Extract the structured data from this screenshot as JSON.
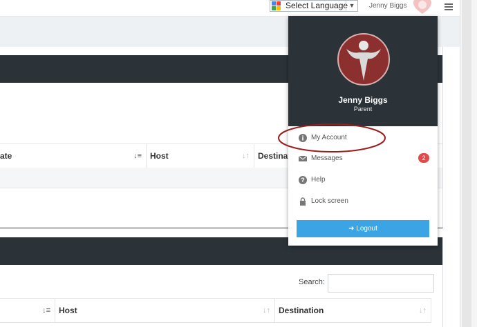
{
  "topbar": {
    "language_select": "Select Language",
    "username": "Jenny Biggs"
  },
  "table1": {
    "columns": [
      "ate",
      "Host",
      "Destinat"
    ]
  },
  "table2": {
    "search_label": "Search:",
    "search_value": "",
    "columns": [
      "",
      "Host",
      "Destination"
    ]
  },
  "dropdown": {
    "name": "Jenny Biggs",
    "role": "Parent",
    "items": [
      {
        "label": "My Account",
        "icon": "info-icon"
      },
      {
        "label": "Messages",
        "icon": "envelope-icon",
        "badge": "2"
      },
      {
        "label": "Help",
        "icon": "question-icon"
      },
      {
        "label": "Lock screen",
        "icon": "lock-icon"
      }
    ],
    "logout_label": "Logout"
  },
  "colors": {
    "dark": "#2b3339",
    "accent": "#3ba4e4",
    "badge": "#e14b4b",
    "highlight_oval": "#9b1c1c"
  }
}
